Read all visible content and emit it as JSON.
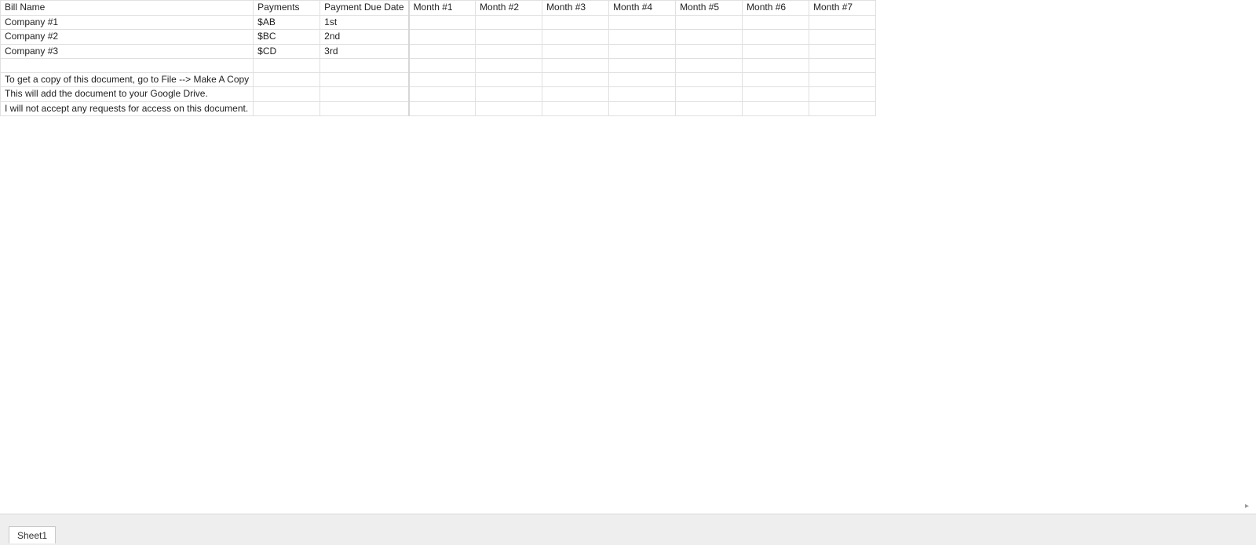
{
  "sheet": {
    "headers": [
      "Bill Name",
      "Payments",
      "Payment Due Date",
      "Month #1",
      "Month #2",
      "Month #3",
      "Month #4",
      "Month #5",
      "Month #6",
      "Month #7"
    ],
    "rows": [
      {
        "bill_name": "Company #1",
        "payments": "$AB",
        "due_date": "1st",
        "months": [
          "",
          "",
          "",
          "",
          "",
          "",
          ""
        ]
      },
      {
        "bill_name": "Company #2",
        "payments": "$BC",
        "due_date": "2nd",
        "months": [
          "",
          "",
          "",
          "",
          "",
          "",
          ""
        ]
      },
      {
        "bill_name": "Company #3",
        "payments": "$CD",
        "due_date": "3rd",
        "months": [
          "",
          "",
          "",
          "",
          "",
          "",
          ""
        ]
      }
    ],
    "notes": [
      "To get a copy of this document, go to File --> Make A Copy",
      "This will add the document to your Google Drive.",
      "I will not accept any requests for access on this document."
    ]
  },
  "footer": {
    "active_tab": "Sheet1"
  }
}
